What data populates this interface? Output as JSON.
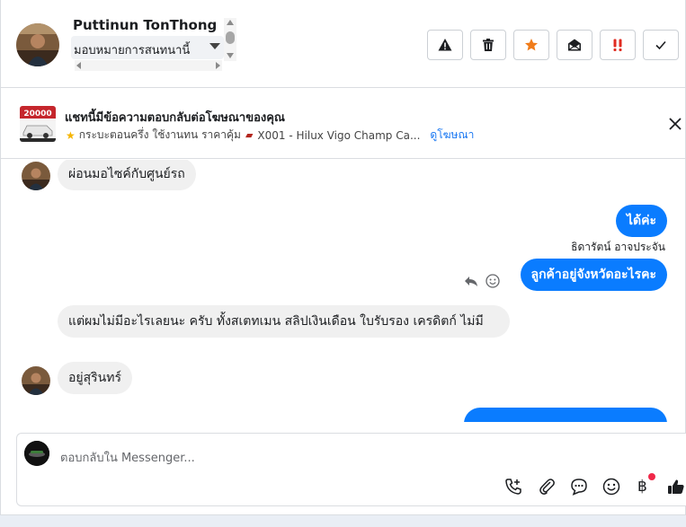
{
  "header": {
    "contact_name": "Puttinun TonThong",
    "assign_label": "มอบหมายการสนทนานี้",
    "actions": [
      {
        "name": "spam-button",
        "icon": "warning-icon"
      },
      {
        "name": "delete-button",
        "icon": "trash-icon"
      },
      {
        "name": "star-button",
        "icon": "star-icon"
      },
      {
        "name": "mark-unread-button",
        "icon": "envelope-open-icon"
      },
      {
        "name": "follow-up-button",
        "icon": "exclamation-icon"
      },
      {
        "name": "mark-done-button",
        "icon": "check-icon"
      }
    ],
    "colors": {
      "star": "#f07c1a",
      "follow_up": "#e02b20"
    }
  },
  "ad_banner": {
    "title": "แชทนี้มีข้อความตอบกลับต่อโฆษณาของคุณ",
    "ad_text": "กระบะตอนครึ่ง ใช้งานทน ราคาคุ้ม",
    "ad_product": "X001 - Hilux Vigo Champ Ca...",
    "view_ad_link": "ดูโฆษณา",
    "thumb_price": "20000"
  },
  "messages": [
    {
      "direction": "in",
      "text": "ผ่อนมอไซค์กับศูนย์รถ"
    },
    {
      "direction": "out",
      "text": "ได้ค่ะ"
    },
    {
      "direction": "out",
      "sender": "ธิดารัตน์ อาจประจัน",
      "text": "ลูกค้าอยู่จังหวัดอะไรคะ"
    },
    {
      "direction": "in",
      "text": "แต่ผมไม่มีอะไรเลยนะ ครับ ทั้งสเตทเมน สลิปเงินเดือน ใบรับรอง เครดิตก์ ไม่มี"
    },
    {
      "direction": "in",
      "text": "อยู่สุรินทร์"
    }
  ],
  "composer": {
    "placeholder": "ตอบกลับใน Messenger...",
    "currency_symbol": "฿",
    "tools": [
      "call-icon",
      "attachment-icon",
      "saved-reply-icon",
      "emoji-icon",
      "payment-icon",
      "like-icon"
    ]
  },
  "colors": {
    "accent": "#0a7cff",
    "link": "#1877f2",
    "incoming_bubble": "#f0f0f0"
  }
}
